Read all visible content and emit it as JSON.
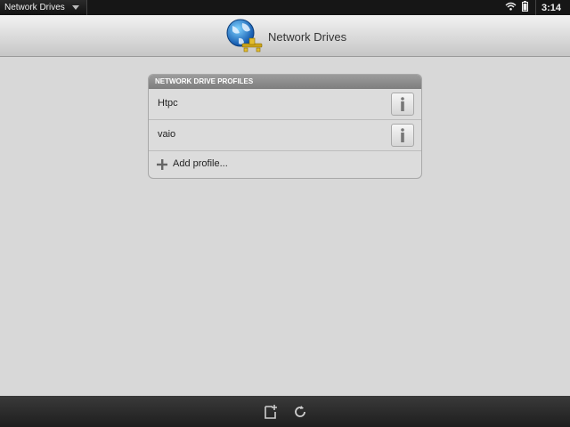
{
  "status_bar": {
    "app_name": "Network Drives",
    "time": "3:14"
  },
  "header": {
    "title": "Network Drives",
    "icon": "globe-network-icon"
  },
  "profiles": {
    "section_title": "NETWORK DRIVE PROFILES",
    "items": [
      {
        "label": "Htpc",
        "action_icon": "info-icon"
      },
      {
        "label": "vaio",
        "action_icon": "info-icon"
      }
    ],
    "add_label": "Add profile..."
  },
  "bottom_bar": {
    "buttons": [
      {
        "icon": "new-document-icon"
      },
      {
        "icon": "refresh-icon"
      }
    ]
  },
  "colors": {
    "background": "#d8d8d8",
    "status_bar": "#161616",
    "section_header": "#8a8a8a"
  }
}
